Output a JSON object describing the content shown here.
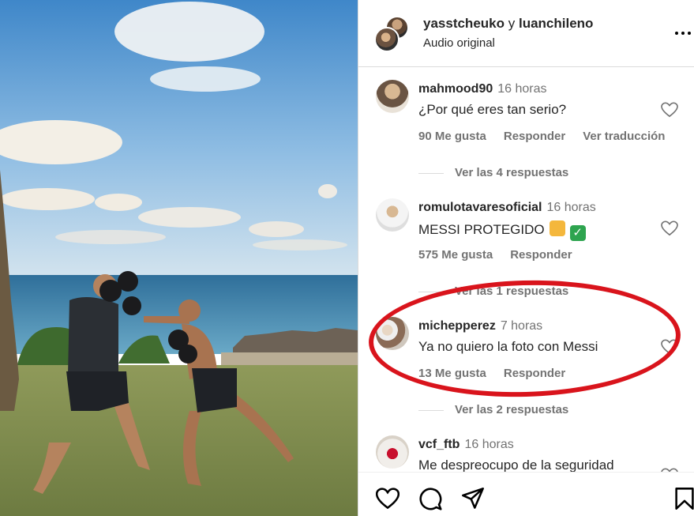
{
  "header": {
    "user1": "yasstcheuko",
    "connector": "y",
    "user2": "luanchileno",
    "audio": "Audio original",
    "icons": [
      "avatar",
      "more-icon"
    ]
  },
  "comments": [
    {
      "username": "mahmood90",
      "time": "16 horas",
      "text": "¿Por qué eres tan serio?",
      "likes": "90 Me gusta",
      "reply": "Responder",
      "translate": "Ver traducción",
      "replies": "Ver las 4 respuestas"
    },
    {
      "username": "romulotavaresoficial",
      "time": "16 horas",
      "text": "MESSI PROTEGIDO",
      "likes": "575 Me gusta",
      "reply": "Responder",
      "replies": "Ver las 1 respuestas"
    },
    {
      "username": "michepperez",
      "time": "7 horas",
      "text": "Ya no quiero la foto con Messi",
      "likes": "13 Me gusta",
      "reply": "Responder",
      "replies": "Ver las 2 respuestas"
    },
    {
      "username": "vcf_ftb",
      "time": "16 horas",
      "text": "Me despreocupo de la seguridad"
    }
  ],
  "colors": {
    "highlight": "#d9141c",
    "muted_text": "#737373",
    "text": "#262626"
  },
  "actionbar_icons": [
    "heart-icon",
    "comment-icon",
    "share-icon",
    "bookmark-icon"
  ]
}
